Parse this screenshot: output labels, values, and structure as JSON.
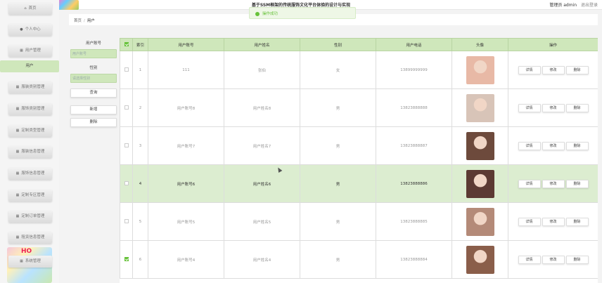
{
  "app": {
    "title": "基于SSM框架的传统服饰文化平台体验的设计与实现",
    "user_label": "管理员 admin",
    "logout": "退出登录"
  },
  "toast": {
    "text": "操作成功"
  },
  "sidebar": {
    "items": [
      {
        "label": "首页",
        "icon": "home-icon"
      },
      {
        "label": "个人中心",
        "icon": "user-icon"
      },
      {
        "label": "用户管理",
        "icon": "grid-icon"
      },
      {
        "label": "用户",
        "icon": ""
      },
      {
        "label": "服装类别管理",
        "icon": "grid-icon"
      },
      {
        "label": "服饰类别管理",
        "icon": "grid-icon"
      },
      {
        "label": "定制类型管理",
        "icon": "grid-icon"
      },
      {
        "label": "服装信息管理",
        "icon": "grid-icon"
      },
      {
        "label": "服饰信息管理",
        "icon": "grid-icon"
      },
      {
        "label": "定制专区管理",
        "icon": "grid-icon"
      },
      {
        "label": "定制订单管理",
        "icon": "grid-icon"
      },
      {
        "label": "租赁信息管理",
        "icon": "grid-icon"
      },
      {
        "label": "系统管理",
        "icon": "grid-icon"
      }
    ]
  },
  "breadcrumb": {
    "home": "首页",
    "separator": "/",
    "current": "用户"
  },
  "search": {
    "account_label": "用户账号",
    "account_placeholder": "用户账号",
    "gender_label": "性别",
    "gender_placeholder": "请选择性别",
    "query_button": "查询",
    "add_button": "新增",
    "delete_button": "删除"
  },
  "table": {
    "headers": [
      "索引",
      "用户账号",
      "用户姓名",
      "性别",
      "用户电话",
      "头像",
      "操作"
    ],
    "actions": {
      "detail": "详情",
      "edit": "修改",
      "delete": "删除"
    },
    "rows": [
      {
        "index": "1",
        "account": "111",
        "name": "张伯",
        "gender": "女",
        "phone": "13899999999",
        "avatar_color": "#e8b9a6",
        "checked": false,
        "highlight": false
      },
      {
        "index": "2",
        "account": "用户账号8",
        "name": "用户姓名8",
        "gender": "男",
        "phone": "13823888888",
        "avatar_color": "#d8c4b8",
        "checked": false,
        "highlight": false
      },
      {
        "index": "3",
        "account": "用户账号7",
        "name": "用户姓名7",
        "gender": "男",
        "phone": "13823888887",
        "avatar_color": "#6d4a3c",
        "checked": false,
        "highlight": false
      },
      {
        "index": "4",
        "account": "用户账号6",
        "name": "用户姓名6",
        "gender": "男",
        "phone": "13823888886",
        "avatar_color": "#5c3a33",
        "checked": false,
        "highlight": true
      },
      {
        "index": "5",
        "account": "用户账号5",
        "name": "用户姓名5",
        "gender": "男",
        "phone": "13823888885",
        "avatar_color": "#b48a78",
        "checked": false,
        "highlight": false
      },
      {
        "index": "6",
        "account": "用户账号4",
        "name": "用户姓名4",
        "gender": "男",
        "phone": "13823888884",
        "avatar_color": "#8a5e4a",
        "checked": true,
        "highlight": false
      }
    ]
  },
  "colors": {
    "accent": "#cfe7bb",
    "success": "#67c23a"
  }
}
